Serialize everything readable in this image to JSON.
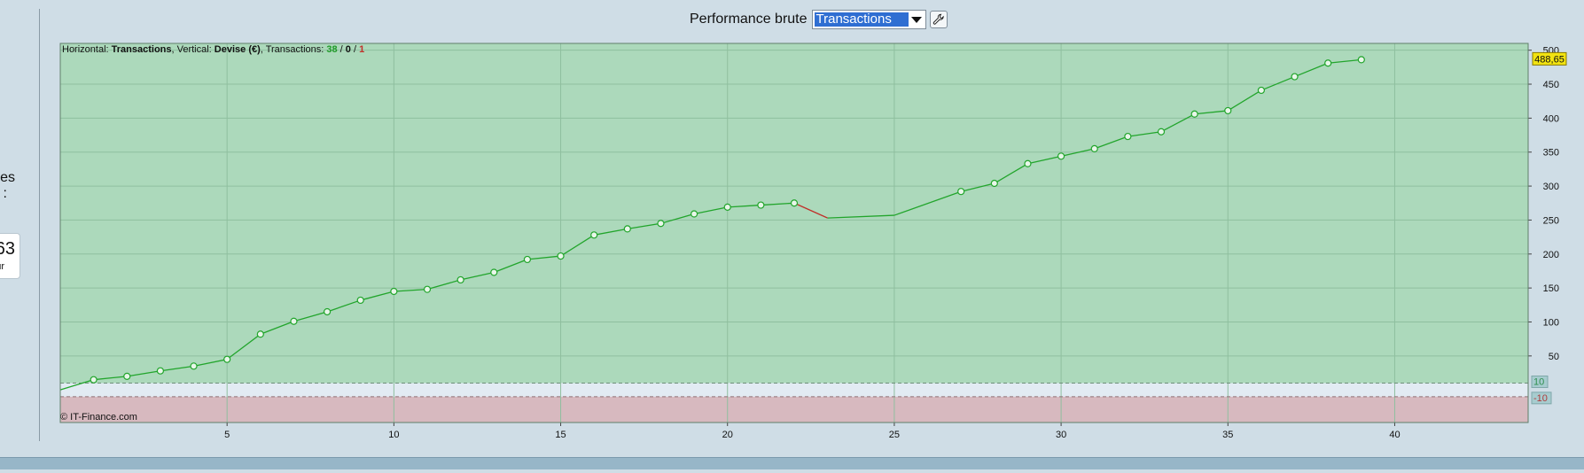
{
  "left_panel": {
    "text_line1": "es",
    "text_line2": ":",
    "box_value": "63",
    "box_unit": "ur"
  },
  "header": {
    "title": "Performance brute",
    "select_value": "Transactions",
    "tool_icon": "wrench-icon"
  },
  "chart_info": {
    "prefix_h": "Horizontal: ",
    "h_value": "Transactions",
    "prefix_v": ", Vertical: ",
    "v_value": "Devise (€)",
    "prefix_t": ", Transactions: ",
    "t_win": "38",
    "sep1": " / ",
    "t_even": "0",
    "sep2": " / ",
    "t_loss": "1"
  },
  "copyright": "© IT-Finance.com",
  "colors": {
    "profit_zone": "#acd9bb",
    "loss_zone": "#d7b9bf",
    "line_up": "#22a52c",
    "line_down": "#c0302a",
    "last_value_bg": "#f2e311",
    "band_label_bg": "#a7cccf"
  },
  "chart_data": {
    "type": "line",
    "title": "",
    "xlabel": "",
    "ylabel": "",
    "xlim": [
      0,
      44
    ],
    "ylim": [
      -48,
      510
    ],
    "x_ticks": [
      5,
      10,
      15,
      20,
      25,
      30,
      35,
      40
    ],
    "y_ticks": [
      50,
      100,
      150,
      200,
      250,
      300,
      350,
      400,
      450,
      500
    ],
    "band": {
      "upper": 10,
      "lower": -10,
      "upper_label": "10",
      "lower_label": "-10"
    },
    "last_value_label": "488,65",
    "grid": true,
    "series": [
      {
        "x": [
          0,
          1,
          2,
          3,
          4,
          5,
          6,
          7,
          8,
          9,
          10,
          11,
          12,
          13,
          14,
          15,
          16,
          17,
          18,
          19,
          20,
          21,
          22,
          23,
          25,
          27,
          28,
          29,
          30,
          31,
          32,
          33,
          34,
          35,
          36,
          37,
          38,
          39
        ],
        "y": [
          0,
          15,
          20,
          28,
          35,
          45,
          82,
          101,
          115,
          132,
          145,
          148,
          162,
          173,
          192,
          197,
          228,
          237,
          245,
          259,
          269,
          272,
          275,
          253,
          257,
          292,
          304,
          333,
          344,
          355,
          373,
          380,
          406,
          411,
          441,
          461,
          481,
          486
        ],
        "markers": [
          false,
          true,
          true,
          true,
          true,
          true,
          true,
          true,
          true,
          true,
          true,
          true,
          true,
          true,
          true,
          true,
          true,
          true,
          true,
          true,
          true,
          true,
          true,
          false,
          false,
          true,
          true,
          true,
          true,
          true,
          true,
          true,
          true,
          true,
          true,
          true,
          true,
          true
        ]
      }
    ]
  }
}
